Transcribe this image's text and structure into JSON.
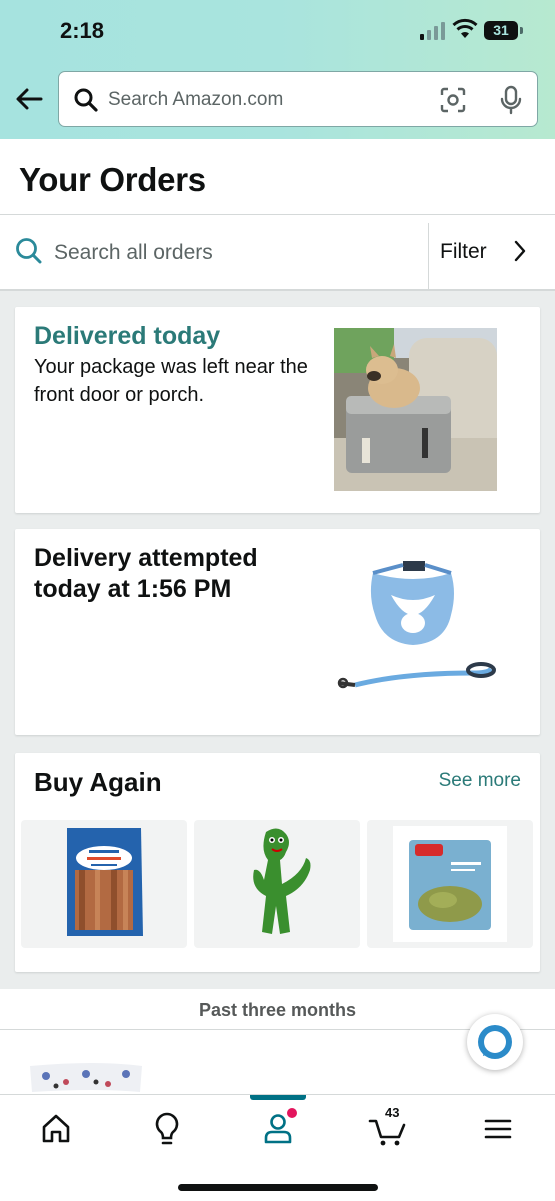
{
  "status_bar": {
    "time": "2:18",
    "battery": "31"
  },
  "search": {
    "placeholder": "Search Amazon.com"
  },
  "page": {
    "title": "Your Orders"
  },
  "order_search": {
    "placeholder": "Search all orders",
    "filter_label": "Filter"
  },
  "cards": {
    "delivered": {
      "status": "Delivered today",
      "message": "Your package was left near the front door or porch."
    },
    "attempted": {
      "status": "Delivery attempted today at 1:56 PM"
    },
    "buy_again": {
      "title": "Buy Again",
      "see_more": "See more"
    }
  },
  "past_section": {
    "label": "Past three months"
  },
  "bottom_nav": {
    "items": [
      "home-icon",
      "lightbulb-icon",
      "account-icon",
      "cart-icon",
      "menu-icon"
    ],
    "cart_count": "43",
    "active": "account"
  },
  "colors": {
    "accent": "#2b7a78",
    "header_gradient": "#a6e3df",
    "nav_active": "#007185",
    "notification": "#e3155d"
  }
}
